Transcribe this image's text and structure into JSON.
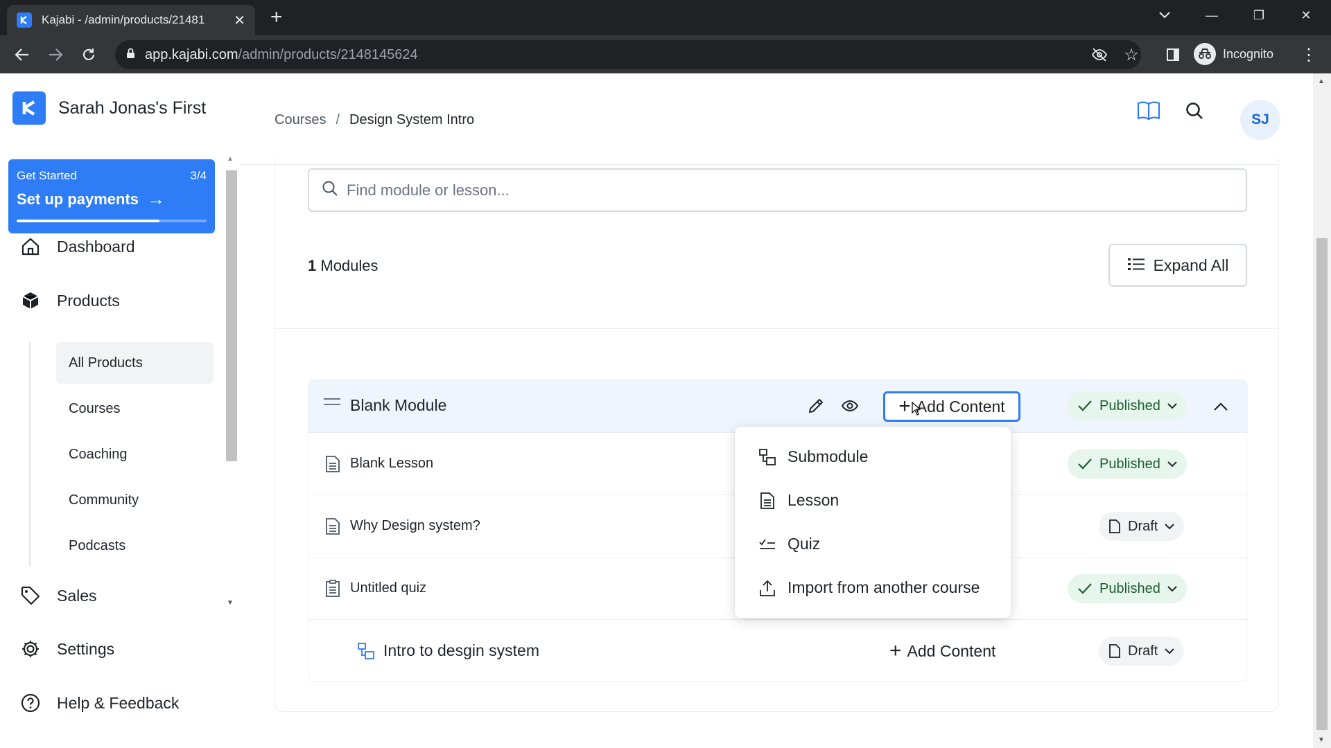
{
  "browser": {
    "tab_title": "Kajabi - /admin/products/21481",
    "url_host": "app.kajabi.com",
    "url_path": "/admin/products/2148145624",
    "profile_label": "Incognito"
  },
  "sidebar": {
    "site_name": "Sarah Jonas's First",
    "get_started": {
      "label": "Get Started",
      "progress_text": "3/4",
      "progress_fraction": 0.75,
      "cta": "Set up payments"
    },
    "nav": [
      {
        "label": "Dashboard",
        "icon": "home-icon"
      },
      {
        "label": "Products",
        "icon": "box-icon"
      },
      {
        "label": "Sales",
        "icon": "tag-icon"
      },
      {
        "label": "Settings",
        "icon": "gear-icon"
      },
      {
        "label": "Help & Feedback",
        "icon": "help-circle-icon"
      }
    ],
    "products_sub": [
      {
        "label": "All Products",
        "active": true
      },
      {
        "label": "Courses",
        "active": false
      },
      {
        "label": "Coaching",
        "active": false
      },
      {
        "label": "Community",
        "active": false
      },
      {
        "label": "Podcasts",
        "active": false
      }
    ]
  },
  "header": {
    "breadcrumb": [
      "Courses",
      "Design System Intro"
    ],
    "avatar_initials": "SJ"
  },
  "main": {
    "search_placeholder": "Find module or lesson...",
    "modules_count": "1",
    "modules_label": "Modules",
    "expand_all_label": "Expand All",
    "module": {
      "title": "Blank Module",
      "add_content_label": "Add Content",
      "status": "Published",
      "rows": [
        {
          "title": "Blank Lesson",
          "type": "lesson",
          "status": "Published"
        },
        {
          "title": "Why Design system?",
          "type": "lesson",
          "status": "Draft"
        },
        {
          "title": "Untitled quiz",
          "type": "quiz",
          "status": "Published"
        },
        {
          "title": "Intro to desgin system",
          "type": "submodule",
          "status": "Draft",
          "add_content_label": "Add Content"
        }
      ]
    },
    "add_content_menu": [
      {
        "label": "Submodule",
        "icon": "submodule-icon"
      },
      {
        "label": "Lesson",
        "icon": "document-icon"
      },
      {
        "label": "Quiz",
        "icon": "quiz-checklist-icon"
      },
      {
        "label": "Import from another course",
        "icon": "upload-icon"
      }
    ]
  },
  "colors": {
    "brand": "#2e7cf6",
    "published_bg": "#e6f6ec",
    "published_text": "#1e5e34",
    "module_header_bg": "#eef5fd"
  }
}
